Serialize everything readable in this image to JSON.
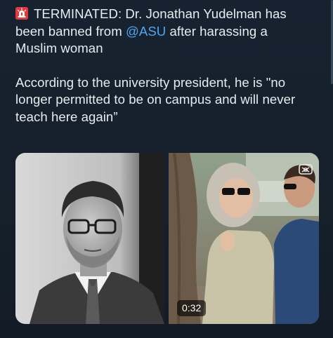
{
  "tweet": {
    "alert_icon": "siren-icon",
    "lines": [
      "TERMINATED: Dr. Jonathan Yudelman has",
      "been banned from ",
      "@ASU",
      " after harassing a",
      "Muslim woman",
      "According to the university president, he is \"no",
      "longer permitted to be on campus and will never",
      "teach here again”"
    ]
  },
  "media": {
    "left_photo_icon": "portrait-photo",
    "right_video_icon": "video-thumbnail",
    "video_duration": "0:32",
    "corner_icon": "gif-badge-icon"
  },
  "colors": {
    "background": "#15202b",
    "text": "#e7ecf0",
    "mention": "#4da6f2",
    "siren": "#e23a3f"
  }
}
